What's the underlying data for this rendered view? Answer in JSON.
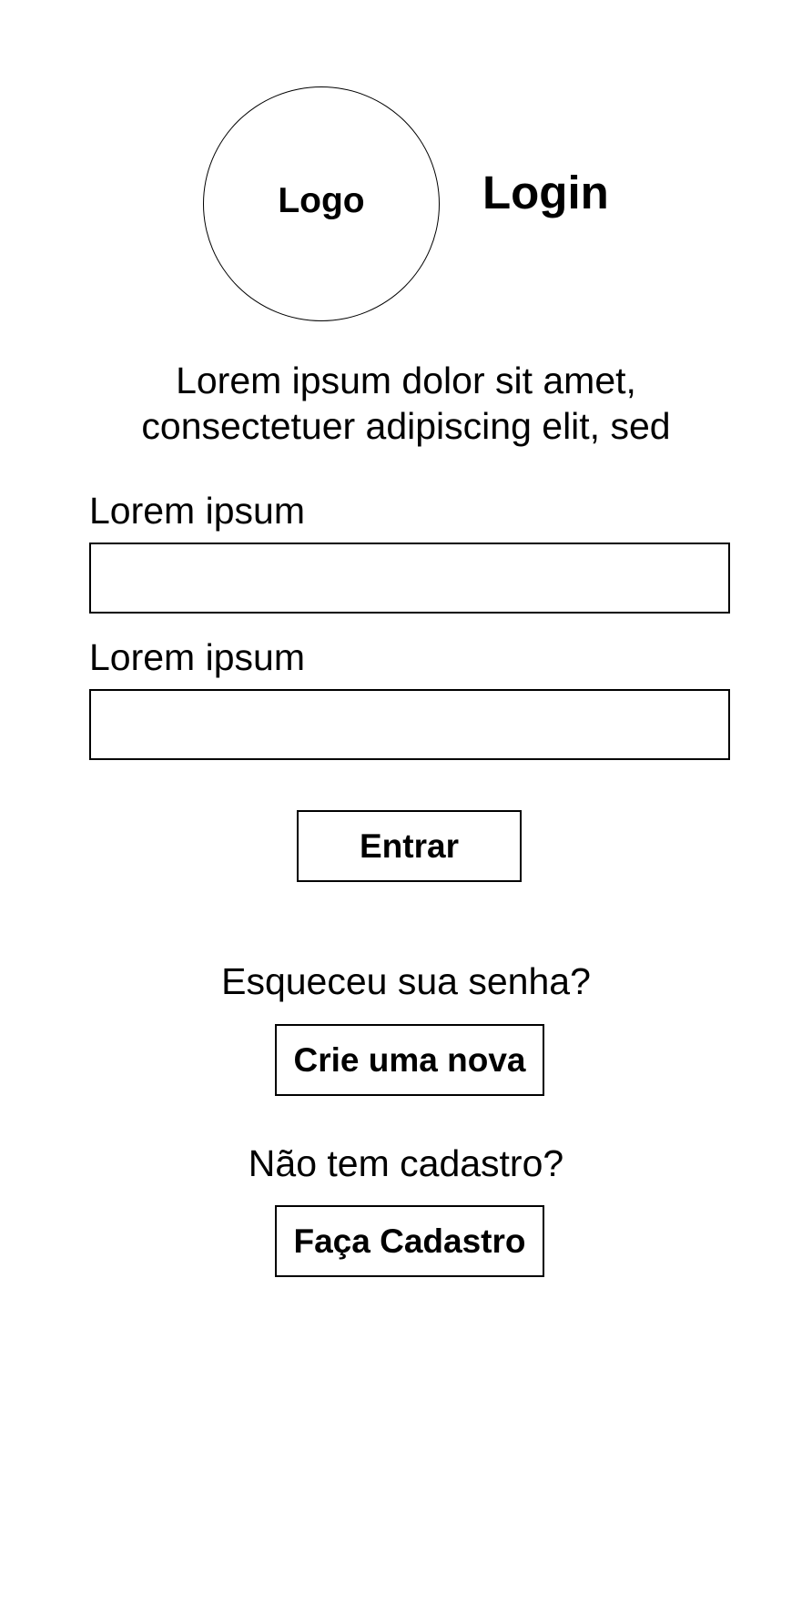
{
  "header": {
    "logo_label": "Logo",
    "title": "Login"
  },
  "description": [
    "Lorem ipsum dolor sit amet,",
    "consectetuer adipiscing elit, sed"
  ],
  "form": {
    "field1": {
      "label": "Lorem ipsum",
      "value": ""
    },
    "field2": {
      "label": "Lorem ipsum",
      "value": ""
    },
    "submit_label": "Entrar"
  },
  "forgot": {
    "question": "Esqueceu sua senha?",
    "button_label": "Crie uma nova"
  },
  "signup": {
    "question": "Não tem cadastro?",
    "button_label": "Faça Cadastro"
  }
}
